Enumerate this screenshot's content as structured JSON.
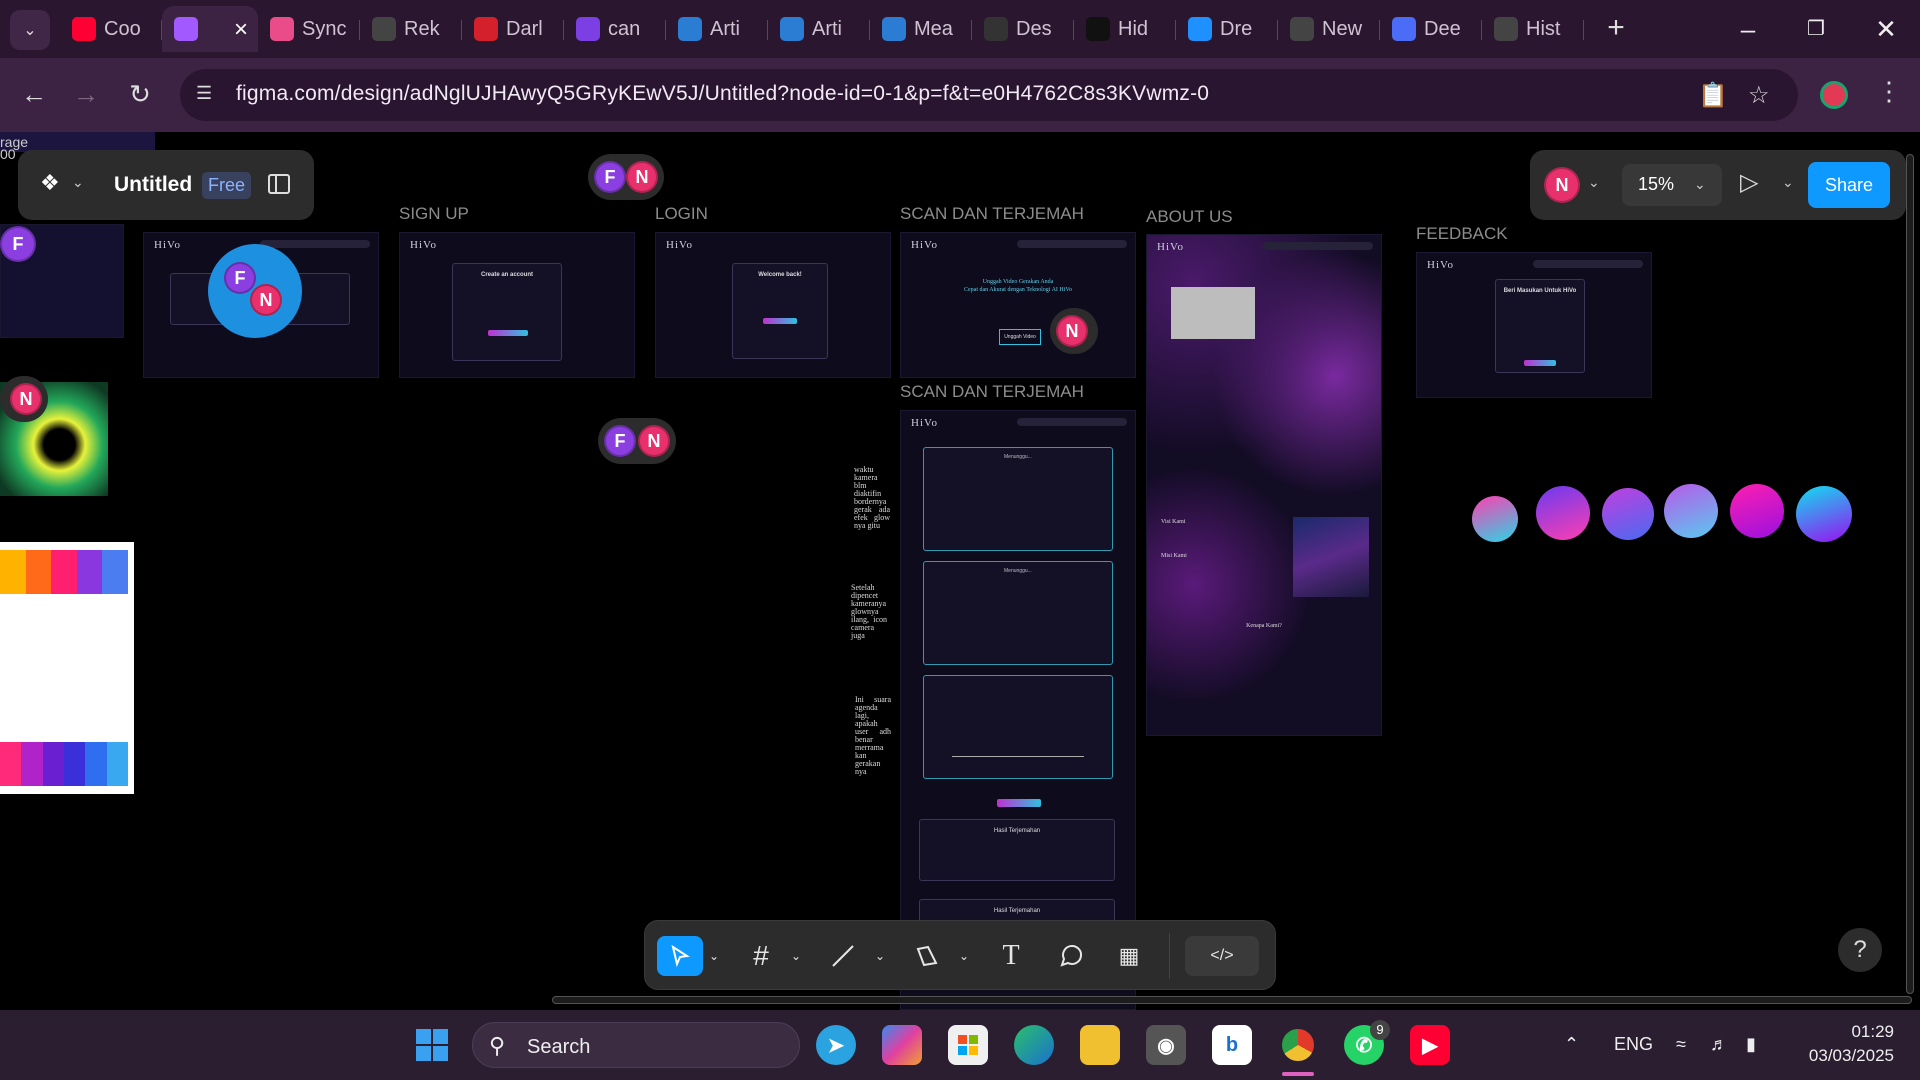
{
  "browser": {
    "tabs": [
      {
        "label": "Coo",
        "icon": "youtube-icon",
        "color": "#ff0033",
        "active": false
      },
      {
        "label": "",
        "icon": "figma-icon",
        "color": "#a259ff",
        "active": true
      },
      {
        "label": "Sync",
        "icon": "dribbble-icon",
        "color": "#ea4c89",
        "active": false
      },
      {
        "label": "Rek",
        "icon": "openai-icon",
        "color": "#444444",
        "active": false
      },
      {
        "label": "Darl",
        "icon": "w-logo-icon",
        "color": "#d4202a",
        "active": false
      },
      {
        "label": "can",
        "icon": "canva-icon",
        "color": "#7b3fe4",
        "active": false
      },
      {
        "label": "Arti",
        "icon": "word-icon",
        "color": "#2b7cd3",
        "active": false
      },
      {
        "label": "Arti",
        "icon": "word-icon",
        "color": "#2b7cd3",
        "active": false
      },
      {
        "label": "Mea",
        "icon": "word-icon",
        "color": "#2b7cd3",
        "active": false
      },
      {
        "label": "Des",
        "icon": "leaf-icon",
        "color": "#333333",
        "active": false
      },
      {
        "label": "Hid",
        "icon": "triangle-icon",
        "color": "#111111",
        "active": false
      },
      {
        "label": "Dre",
        "icon": "arrow-icon",
        "color": "#1e90ff",
        "active": false
      },
      {
        "label": "New",
        "icon": "openai-icon",
        "color": "#444444",
        "active": false
      },
      {
        "label": "Dee",
        "icon": "play-icon",
        "color": "#4a6cf7",
        "active": false
      },
      {
        "label": "Hist",
        "icon": "history-icon",
        "color": "#444444",
        "active": false
      }
    ],
    "url": "figma.com/design/adNglUJHAwyQ5GRyKEwV5J/Untitled?node-id=0-1&p=f&t=e0H4762C8s3KVwmz-0"
  },
  "figma": {
    "file_name": "Untitled",
    "plan_badge": "Free",
    "zoom": "15%",
    "share_label": "Share",
    "user_initial": "N",
    "help_label": "?"
  },
  "canvas": {
    "clipped_label": "rage\n00",
    "frames": {
      "signup": "SIGN UP",
      "login": "LOGIN",
      "scan1": "SCAN DAN TERJEMAH",
      "scan2": "SCAN DAN TERJEMAH",
      "about": "ABOUT US",
      "feedback": "FEEDBACK"
    },
    "logo_text": "HiVo",
    "card_titles": {
      "signup": "Create an account",
      "login": "Welcome back!",
      "feedback": "Beri Masukan Untuk HiVo",
      "about_visi": "Visi Kami",
      "about_misi": "Misi Kami",
      "about_why": "Kenapa Kami?",
      "scan_heading1": "Unggah Video Gerakan Anda",
      "scan_heading2": "Cepat dan Akurat dengan Teknologi AI HiVo",
      "scan_button": "Unggah Video",
      "scan_result": "Hasil Terjemahan",
      "scan_loading": "Menunggu..."
    },
    "notes": [
      "waktu kamera blm diaktifin bordernya gerak ada efek glow nya gitu",
      "Setelah dipencet kameranya glownya ilang, icon camera juga",
      "Ini suara agenda lagi, apakah user adh benar merrama kan gerakan nya"
    ],
    "avatars": {
      "f": "F",
      "n": "N"
    },
    "colors": {
      "swatches_top": [
        "#ffb300",
        "#ff6a1a",
        "#ff1f6e",
        "#8a37e0",
        "#4b7df0"
      ],
      "swatches_bottom": [
        "#ff2a7a",
        "#b023c8",
        "#6a1fd0",
        "#3a2fd8",
        "#2f6ef0",
        "#3aa8f0"
      ],
      "orbs": [
        [
          "#ff3fb0",
          "#2ad6e6"
        ],
        [
          "#6a3af0",
          "#ff3fb0"
        ],
        [
          "#c03fe0",
          "#4a6af0"
        ],
        [
          "#b75ae8",
          "#5ac8f0"
        ],
        [
          "#ff1fb0",
          "#9a10e0"
        ],
        [
          "#10e0f0",
          "#9a10f0"
        ]
      ]
    }
  },
  "taskbar": {
    "search_placeholder": "Search",
    "language": "ENG",
    "time": "01:29",
    "date": "03/03/2025",
    "whatsapp_badge": "9"
  }
}
